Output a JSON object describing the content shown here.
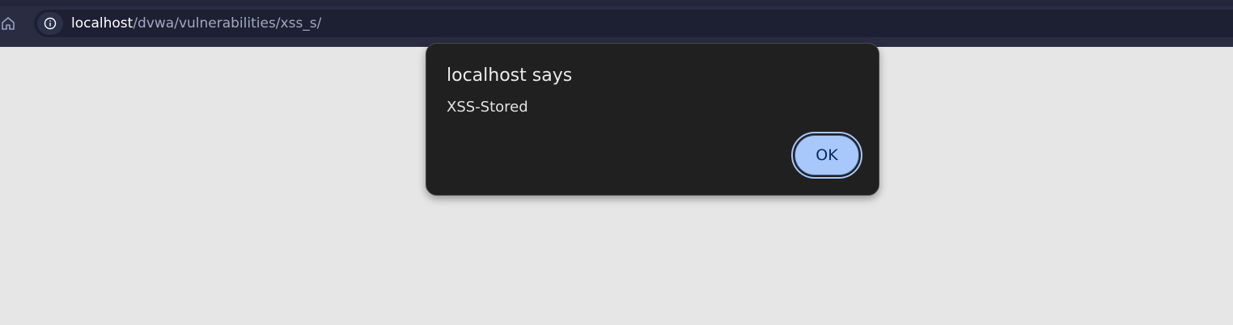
{
  "browser": {
    "url_host": "localhost",
    "url_path": "/dvwa/vulnerabilities/xss_s/",
    "home_icon": "home-icon",
    "site_info_icon": "info-icon"
  },
  "dialog": {
    "title": "localhost says",
    "message": "XSS-Stored",
    "ok_label": "OK"
  },
  "colors": {
    "toolbar": "#2a2d42",
    "page_background": "#e6e6e6",
    "dialog_background": "#202020",
    "button_accent": "#a8c7fa"
  }
}
